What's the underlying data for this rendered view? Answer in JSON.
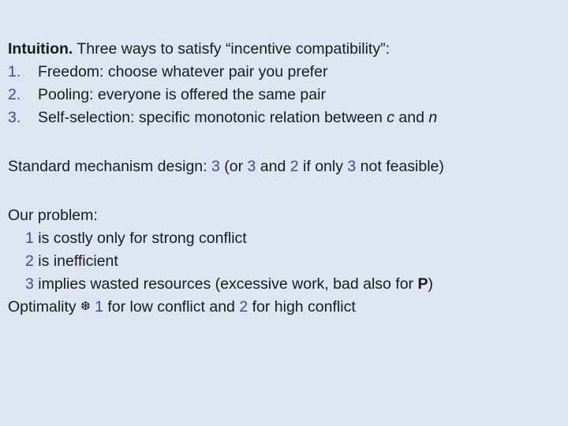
{
  "slide": {
    "background_color": "#dce5f1",
    "text_color": "#1a1a1a",
    "accent_color": "#3b4a9e",
    "intro": {
      "lead_bold": "Intuition.",
      "lead_rest": " Three ways to satisfy  “incentive compatibility”:"
    },
    "numbered_list": [
      {
        "marker": "1.",
        "text": "Freedom: choose whatever pair you prefer"
      },
      {
        "marker": "2.",
        "text": "Pooling: everyone is offered the same pair"
      },
      {
        "marker": "3.",
        "text_before": "Self-selection: specific monotonic relation between ",
        "var_1": "c",
        "text_middle": " and ",
        "var_2": "n"
      }
    ],
    "standard": {
      "label": "Standard mechanism design: ",
      "n1": "3",
      "t1": " (or ",
      "n2": "3",
      "t2": " and ",
      "n3": "2",
      "t3": " if only ",
      "n4": "3",
      "t4": " not feasible)"
    },
    "problem": {
      "heading": "Our problem:",
      "items": [
        {
          "num": "1",
          "text": " is costly only for strong conflict"
        },
        {
          "num": "2",
          "text": " is inefficient"
        },
        {
          "num": "3",
          "text_before": " implies wasted resources (excessive work, bad also for ",
          "bold_token": "P",
          "text_after": ")"
        }
      ],
      "optimality": {
        "label": "Optimality ",
        "icon_glyph": "❆",
        "space_after_icon": " ",
        "n1": "1",
        "t1": " for low conflict and ",
        "n2": "2",
        "t2": " for high conflict"
      }
    }
  }
}
